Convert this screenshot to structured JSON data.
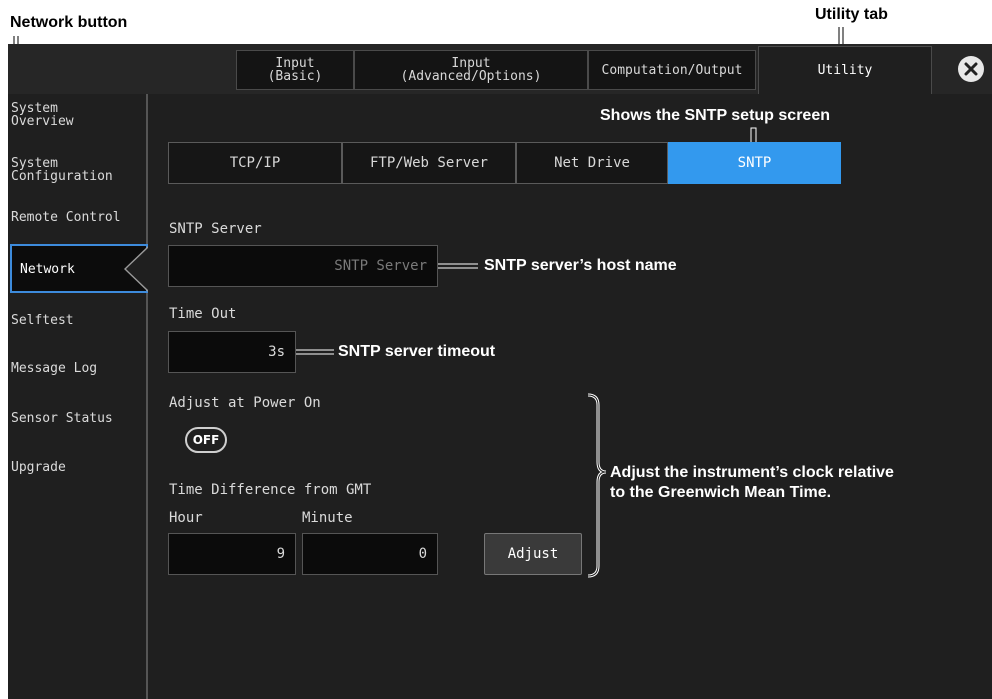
{
  "callouts": {
    "network_button": "Network button",
    "utility_tab": "Utility tab",
    "sntp_setup": "Shows the SNTP setup screen",
    "host_name": "SNTP server’s host name",
    "timeout": "SNTP server timeout",
    "adjust_line1": "Adjust the instrument’s clock relative",
    "adjust_line2": "to the Greenwich Mean Time."
  },
  "tabs": {
    "basic_line1": "Input",
    "basic_line2": "(Basic)",
    "adv_line1": "Input",
    "adv_line2": "(Advanced/Options)",
    "computation": "Computation/Output",
    "utility": "Utility"
  },
  "sidebar": {
    "system_overview_1": "System",
    "system_overview_2": "Overview",
    "system_config_1": "System",
    "system_config_2": "Configuration",
    "remote_control": "Remote Control",
    "network": "Network",
    "selftest": "Selftest",
    "message_log": "Message Log",
    "sensor_status": "Sensor Status",
    "upgrade": "Upgrade"
  },
  "subtabs": {
    "tcpip": "TCP/IP",
    "ftp": "FTP/Web Server",
    "netdrive": "Net Drive",
    "sntp": "SNTP"
  },
  "form": {
    "sntp_server_label": "SNTP Server",
    "sntp_server_placeholder": "SNTP Server",
    "timeout_label": "Time Out",
    "timeout_value": "3s",
    "adjust_power_label": "Adjust at Power On",
    "adjust_power_state": "OFF",
    "time_diff_label": "Time Difference from GMT",
    "hour_label": "Hour",
    "minute_label": "Minute",
    "hour_value": "9",
    "minute_value": "0",
    "adjust_button": "Adjust"
  },
  "colors": {
    "active_subtab": "#3399ee",
    "selected_border": "#3d8bdc"
  }
}
